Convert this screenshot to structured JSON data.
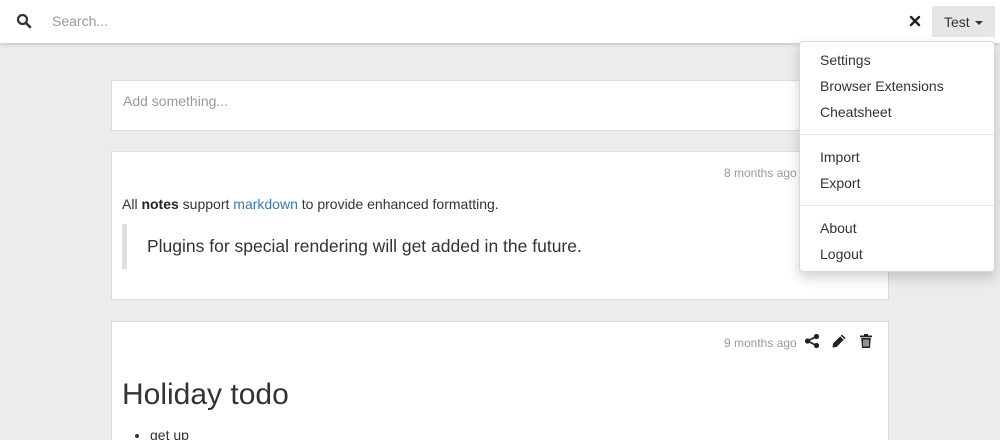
{
  "search": {
    "placeholder": "Search..."
  },
  "user_menu": {
    "label": "Test",
    "items": [
      "Settings",
      "Browser Extensions",
      "Cheatsheet",
      "Import",
      "Export",
      "About",
      "Logout"
    ]
  },
  "composer": {
    "placeholder": "Add something..."
  },
  "notes": [
    {
      "timestamp": "8 months ago",
      "text_prefix": "All ",
      "text_bold": "notes",
      "text_middle": " support ",
      "text_link": "markdown",
      "text_suffix": " to provide enhanced formatting.",
      "quote": "Plugins for special rendering will get added in the future."
    },
    {
      "timestamp": "9 months ago",
      "heading": "Holiday todo",
      "todos": [
        "get up"
      ]
    }
  ],
  "icons": {
    "search": "search-icon",
    "clear": "close-icon",
    "share": "share-icon",
    "edit": "pencil-icon",
    "trash": "trash-icon"
  }
}
